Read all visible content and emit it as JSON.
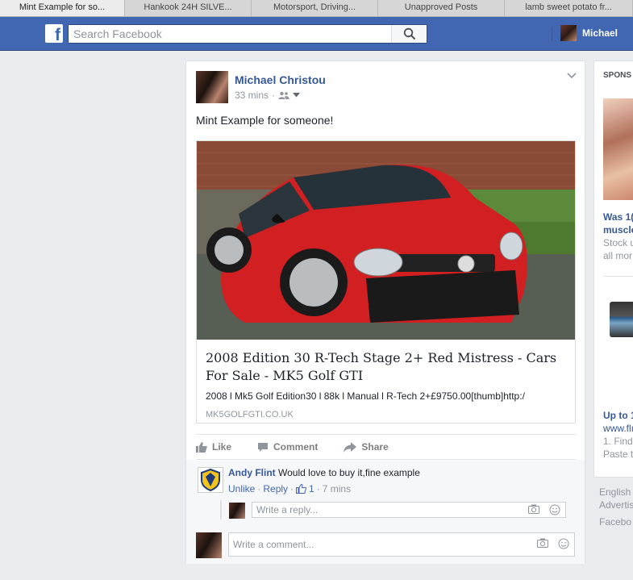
{
  "browser": {
    "tabs": [
      {
        "label": "Mint Example for so...",
        "active": true
      },
      {
        "label": "Hankook 24H SILVE...",
        "active": false
      },
      {
        "label": "Motorsport, Driving...",
        "active": false
      },
      {
        "label": "Unapproved Posts",
        "active": false
      },
      {
        "label": "lamb sweet potato fr...",
        "active": false
      }
    ]
  },
  "header": {
    "logo": "f",
    "search_placeholder": "Search Facebook",
    "user_name": "Michael",
    "brand_color": "#4267b2"
  },
  "post": {
    "author": "Michael Christou",
    "time": "33 mins",
    "privacy_icon": "friends-icon",
    "text": "Mint Example for someone!",
    "link": {
      "title": "2008 Edition 30 R-Tech Stage 2+ Red Mistress - Cars For Sale - MK5 Golf GTI",
      "description": "2008 l Mk5 Golf Edition30 l 88k l Manual l R-Tech 2+£9750.00[thumb]http:/",
      "domain": "MK5GOLFGTI.CO.UK"
    },
    "actions": {
      "like": "Like",
      "comment": "Comment",
      "share": "Share"
    }
  },
  "comment": {
    "author": "Andy Flint",
    "text": "Would love to buy it,fine example",
    "unlike": "Unlike",
    "reply": "Reply",
    "likes": "1",
    "time": "7 mins",
    "reply_placeholder": "Write a reply...",
    "comment_placeholder": "Write a comment..."
  },
  "sidebar": {
    "heading": "SPONS",
    "ad1_title_1": "Was 1(",
    "ad1_title_2": "muscle",
    "ad1_sub_1": "Stock u",
    "ad1_sub_2": "all mor",
    "ad2_title": "Up to 1",
    "ad2_link": "www.flı",
    "ad2_sub_1": "1. Find",
    "ad2_sub_2": "Paste t"
  },
  "footer": {
    "lang": "English",
    "advertising": "Advertis",
    "facebook": "Facebo"
  }
}
